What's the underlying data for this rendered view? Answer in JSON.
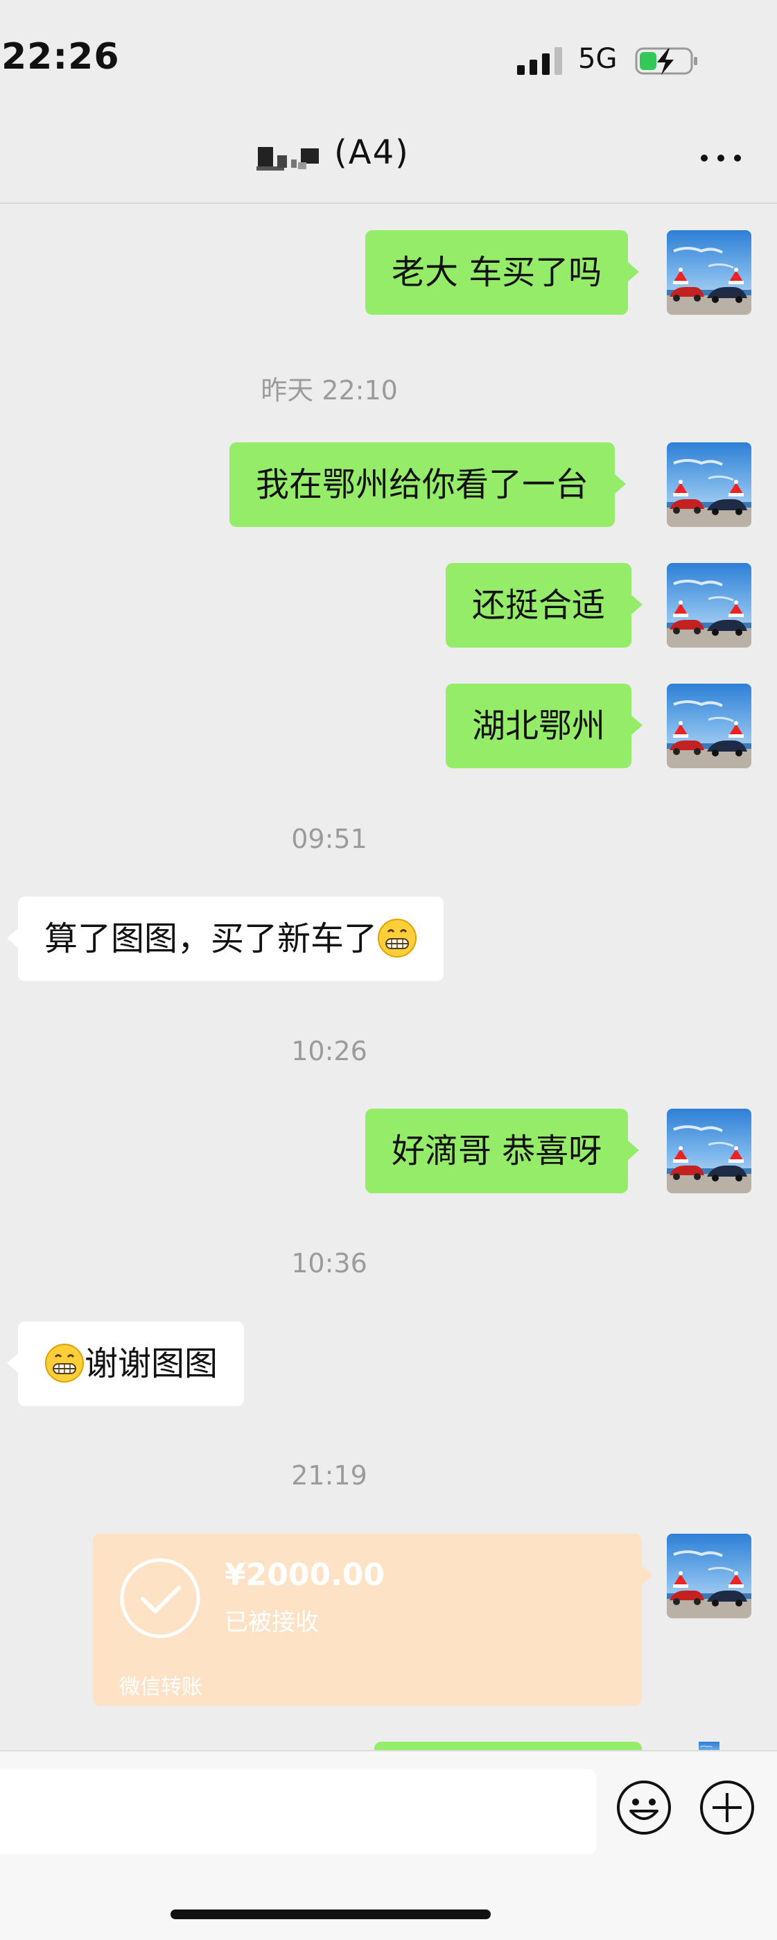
{
  "status_bar": {
    "time": "22:26",
    "network": "5G",
    "battery_state": "charging"
  },
  "header": {
    "title": "(A4)"
  },
  "messages": [
    {
      "from": "me",
      "text": "老大 车买了吗"
    },
    {
      "timestamp": "昨天 22:10"
    },
    {
      "from": "me",
      "text": "我在鄂州给你看了一台"
    },
    {
      "from": "me",
      "text": "还挺合适"
    },
    {
      "from": "me",
      "text": "湖北鄂州"
    },
    {
      "timestamp": "09:51"
    },
    {
      "from": "them",
      "text": "算了图图，买了新车了",
      "emoji_after": "grinning-face"
    },
    {
      "timestamp": "10:26"
    },
    {
      "from": "me",
      "text": "好滴哥 恭喜呀"
    },
    {
      "timestamp": "10:36"
    },
    {
      "from": "them",
      "text": "谢谢图图",
      "emoji_before": "grinning-face"
    },
    {
      "timestamp": "21:19"
    },
    {
      "from": "me",
      "type": "transfer",
      "amount": "¥2000.00",
      "status": "已被接收",
      "label": "微信转账"
    }
  ],
  "colors": {
    "my_bubble": "#95ec69",
    "their_bubble": "#ffffff",
    "transfer_card": "#fde2c6",
    "background": "#ededed"
  },
  "icons": [
    "signal-icon",
    "battery-icon",
    "more-icon",
    "emoji-icon",
    "plus-icon",
    "check-icon"
  ]
}
